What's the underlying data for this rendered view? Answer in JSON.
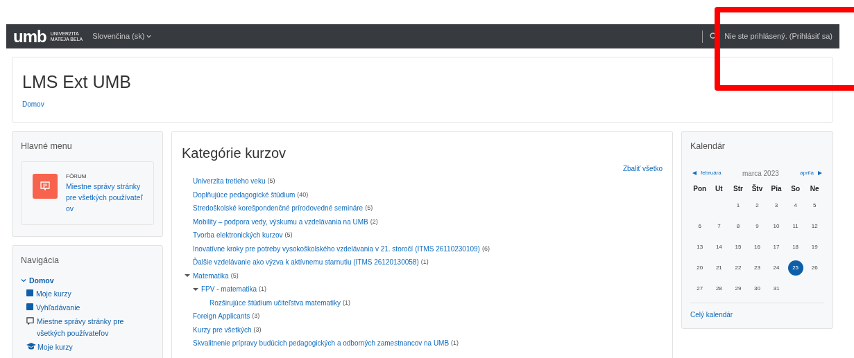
{
  "navbar": {
    "logo": {
      "mark": "umb",
      "line1": "UNIVERZITA",
      "line2": "MATEJA BELA"
    },
    "language": "Slovenčina (sk)",
    "login_text": "Nie ste prihlásený. (Prihlásiť sa)"
  },
  "header": {
    "title": "LMS Ext UMB",
    "breadcrumb": "Domov"
  },
  "main_menu": {
    "title": "Hlavné menu",
    "item": {
      "type": "FÓRUM",
      "name": "Miestne správy stránky pre všetkých používateľ ov"
    }
  },
  "navigation": {
    "title": "Navigácia",
    "items": [
      {
        "label": "Domov",
        "kind": "branch",
        "expanded": true,
        "children": [
          {
            "label": "Moje kurzy",
            "kind": "square"
          },
          {
            "label": "Vyhľadávanie",
            "kind": "square"
          },
          {
            "label": "Miestne správy stránky pre všetkých používateľov",
            "kind": "forum"
          },
          {
            "label": "Moje kurzy",
            "kind": "graduation"
          }
        ]
      }
    ]
  },
  "categories": {
    "title": "Kategórie kurzov",
    "collapse_all": "Zbaliť všetko",
    "items": [
      {
        "name": "Univerzita tretieho veku",
        "count": "(5)"
      },
      {
        "name": "Doplňujúce pedagogické štúdium",
        "count": "(40)"
      },
      {
        "name": "Stredoškolské korešpondenčné prírodovedné semináre",
        "count": "(5)"
      },
      {
        "name": "Mobility – podpora vedy, výskumu a vzdelávania na UMB",
        "count": "(2)"
      },
      {
        "name": "Tvorba elektronických kurzov",
        "count": "(5)"
      },
      {
        "name": "Inovatívne kroky pre potreby vysokoškolského vzdelávania v 21. storočí (ITMS 26110230109)",
        "count": "(6)"
      },
      {
        "name": "Ďalšie vzdelávanie ako výzva k aktívnemu starnutiu (ITMS 26120130058)",
        "count": "(1)"
      },
      {
        "name": "Matematika",
        "count": "(5)",
        "expanded": true,
        "children": [
          {
            "name": "FPV - matematika",
            "count": "(1)",
            "expanded": true,
            "children": [
              {
                "name": "Rozširujúce štúdium učiteľstva matematiky",
                "count": "(1)"
              }
            ]
          }
        ]
      },
      {
        "name": "Foreign Applicants",
        "count": "(3)"
      },
      {
        "name": "Kurzy pre všetkých",
        "count": "(3)"
      },
      {
        "name": "Skvalitnenie prípravy budúcich pedagogických a odborných zamestnancov na UMB",
        "count": "(1)"
      }
    ]
  },
  "calendar": {
    "title": "Kalendár",
    "prev": "februára",
    "month": "marca 2023",
    "next": "apríla",
    "weekdays": [
      "Pon",
      "Ut",
      "Str",
      "Štv",
      "Pia",
      "So",
      "Ne"
    ],
    "weeks": [
      [
        {
          "day": "1",
          "today": false
        },
        {
          "day": "2",
          "today": false
        },
        {
          "day": "3",
          "today": false
        },
        {
          "day": "4",
          "today": false
        },
        {
          "day": "5",
          "today": false
        }
      ],
      [
        {
          "day": "6",
          "today": false
        },
        {
          "day": "7",
          "today": false
        },
        {
          "day": "8",
          "today": false
        },
        {
          "day": "9",
          "today": false
        },
        {
          "day": "10",
          "today": false
        },
        {
          "day": "11",
          "today": false
        },
        {
          "day": "12",
          "today": false
        }
      ],
      [
        {
          "day": "13",
          "today": false
        },
        {
          "day": "14",
          "today": false
        },
        {
          "day": "15",
          "today": false
        },
        {
          "day": "16",
          "today": false
        },
        {
          "day": "17",
          "today": false
        },
        {
          "day": "18",
          "today": false
        },
        {
          "day": "19",
          "today": false
        }
      ],
      [
        {
          "day": "20",
          "today": false
        },
        {
          "day": "21",
          "today": false
        },
        {
          "day": "22",
          "today": false
        },
        {
          "day": "23",
          "today": false
        },
        {
          "day": "24",
          "today": false
        },
        {
          "day": "25",
          "today": true
        },
        {
          "day": "26",
          "today": false
        }
      ],
      [
        {
          "day": "27",
          "today": false
        },
        {
          "day": "28",
          "today": false
        },
        {
          "day": "29",
          "today": false
        },
        {
          "day": "30",
          "today": false
        },
        {
          "day": "31",
          "today": false
        }
      ]
    ],
    "full_link": "Celý kalendár"
  },
  "annotations": [
    {
      "kind": "frame"
    }
  ]
}
